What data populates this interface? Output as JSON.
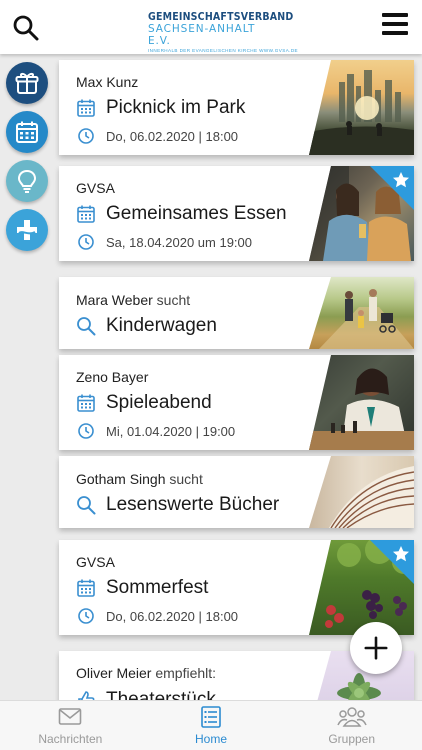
{
  "header": {
    "logo_line1": "GEMEINSCHAFTSVERBAND",
    "logo_line2": "SACHSEN-ANHALT E.V.",
    "logo_line3": "INNERHALB DER EVANGELISCHEN KIRCHE  WWW.GVSA.DE",
    "search_icon": "search-icon",
    "menu_icon": "hamburger-menu-icon"
  },
  "rail": [
    {
      "icon": "gift-icon",
      "color": "#1d4e7f"
    },
    {
      "icon": "calendar-icon",
      "color": "#2589c8"
    },
    {
      "icon": "lightbulb-icon",
      "color": "#6ab7c9"
    },
    {
      "icon": "cross-icon",
      "color": "#3ba3d9"
    }
  ],
  "feed": [
    {
      "author": "Max Kunz",
      "verb": "",
      "title": "Picknick im Park",
      "date": "Do, 06.02.2020 | 18:00",
      "type": "event",
      "starred": false
    },
    {
      "author": "GVSA",
      "verb": "",
      "title": "Gemeinsames Essen",
      "date": "Sa, 18.04.2020 um 19:00",
      "type": "event",
      "starred": true
    },
    {
      "author": "Mara Weber",
      "verb": "sucht",
      "title": "Kinderwagen",
      "date": "",
      "type": "search",
      "starred": false
    },
    {
      "author": "Zeno Bayer",
      "verb": "",
      "title": "Spieleabend",
      "date": "Mi, 01.04.2020 | 19:00",
      "type": "event",
      "starred": false
    },
    {
      "author": "Gotham Singh",
      "verb": "sucht",
      "title": "Lesenswerte Bücher",
      "date": "",
      "type": "search",
      "starred": false
    },
    {
      "author": "GVSA",
      "verb": "",
      "title": "Sommerfest",
      "date": "Do, 06.02.2020 | 18:00",
      "type": "event",
      "starred": true
    },
    {
      "author": "Oliver Meier",
      "verb": "empfiehlt:",
      "title": "Theaterstück",
      "date": "",
      "type": "recommend",
      "starred": false
    }
  ],
  "bottom_nav": [
    {
      "label": "Nachrichten",
      "icon": "envelope-icon",
      "active": false
    },
    {
      "label": "Home",
      "icon": "home-list-icon",
      "active": true
    },
    {
      "label": "Gruppen",
      "icon": "group-icon",
      "active": false
    }
  ],
  "colors": {
    "accent": "#2b8bd1",
    "icon_blue": "#3a8fd0",
    "star_blue": "#2d9bdd"
  }
}
